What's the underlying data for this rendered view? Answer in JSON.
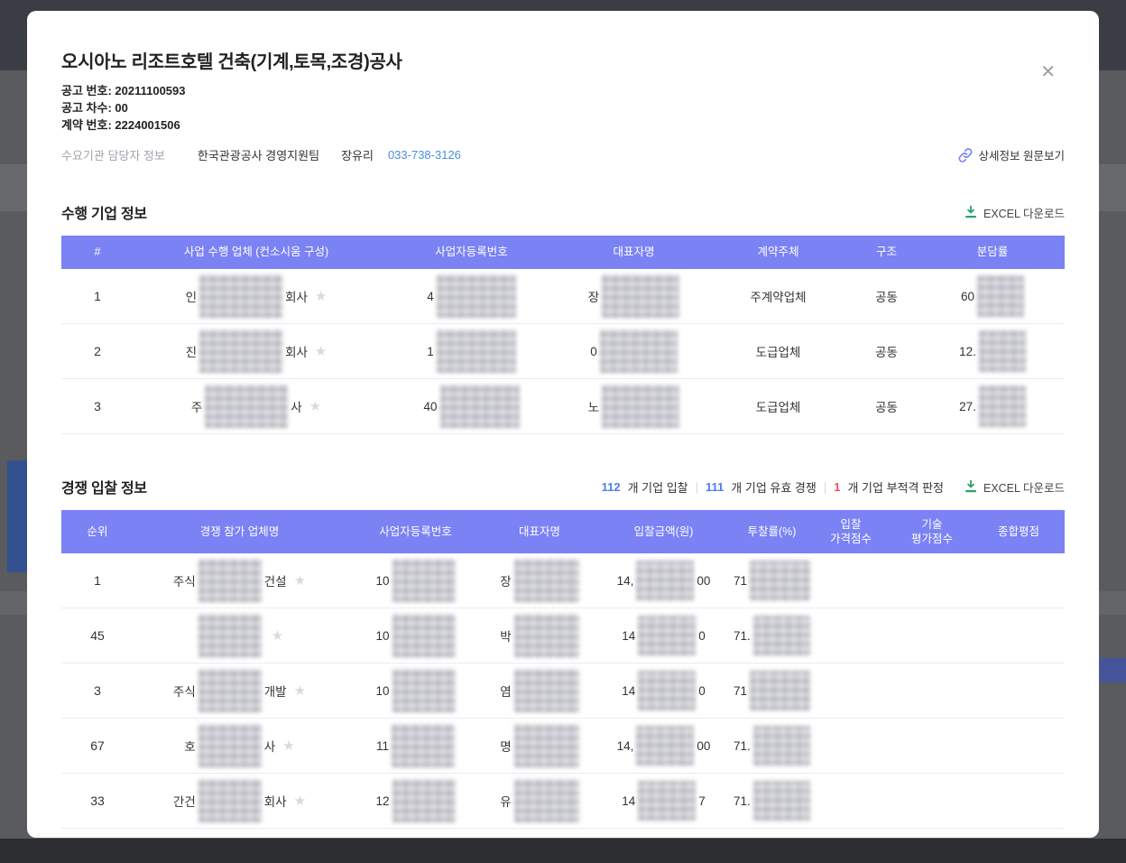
{
  "colors": {
    "table_header": "#7b82f4",
    "phone_link": "#4a8fdb",
    "stat_blue": "#4a7df7",
    "stat_red": "#ef5064",
    "excel_green": "#2ea06b",
    "link_icon_purple": "#7b82f4"
  },
  "icons": {
    "close": "✕",
    "star": "★",
    "separator": "|"
  },
  "modal": {
    "title": "오시아노 리조트호텔 건축(기계,토목,조경)공사",
    "meta": [
      {
        "text": "공고 번호: 20211100593"
      },
      {
        "text": "공고 차수: 00"
      },
      {
        "text": "계약 번호: 2224001506"
      }
    ],
    "contact": {
      "label": "수요기관 담당자 정보",
      "org": "한국관광공사 경영지원팀",
      "person": "장유리",
      "phone": "033-738-3126",
      "detail_link": "상세정보 원문보기"
    }
  },
  "perform_section": {
    "title": "수행 기업 정보",
    "excel_label": "EXCEL 다운로드",
    "table": {
      "headers": [
        "#",
        "사업 수행 업체 (컨소시움 구성)",
        "사업자등록번호",
        "대표자명",
        "계약주체",
        "구조",
        "분담률"
      ],
      "rows": [
        {
          "rank": "1",
          "company_prefix": "인",
          "company_suffix": "회사",
          "biz_prefix": "4",
          "rep_prefix": "장",
          "contract": "주계약업체",
          "structure": "공동",
          "share_prefix": "60"
        },
        {
          "rank": "2",
          "company_prefix": "진",
          "company_suffix": "회사",
          "biz_prefix": "1",
          "rep_prefix": "0",
          "contract": "도급업체",
          "structure": "공동",
          "share_prefix": "12."
        },
        {
          "rank": "3",
          "company_prefix": "주",
          "company_suffix": "사",
          "biz_prefix": "40",
          "rep_prefix": "노",
          "contract": "도급업체",
          "structure": "공동",
          "share_prefix": "27."
        }
      ]
    }
  },
  "bid_section": {
    "title": "경쟁 입찰 정보",
    "stats": [
      {
        "num": "112",
        "text": "개 기업 입찰"
      },
      {
        "num": "111",
        "text": "개 기업 유효 경쟁"
      },
      {
        "num": "1",
        "text": "개 기업 부적격 판정"
      }
    ],
    "excel_label": "EXCEL 다운로드",
    "table": {
      "headers": [
        "순위",
        "경쟁 참가 업체명",
        "사업자등록번호",
        "대표자명",
        "입찰금액(원)",
        "투찰률(%)",
        "입찰\n가격점수",
        "기술\n평가점수",
        "종합평점"
      ],
      "rows": [
        {
          "rank": "1",
          "company_prefix": "주식",
          "company_suffix": "건설",
          "biz_prefix": "10",
          "rep_prefix": "장",
          "amount_prefix": "14,",
          "amount_suffix": "00",
          "rate_prefix": "71"
        },
        {
          "rank": "45",
          "company_prefix": "",
          "company_suffix": "",
          "biz_prefix": "10",
          "rep_prefix": "박",
          "amount_prefix": "14",
          "amount_suffix": "0",
          "rate_prefix": "71."
        },
        {
          "rank": "3",
          "company_prefix": "주식",
          "company_suffix": "개발",
          "biz_prefix": "10",
          "rep_prefix": "염",
          "amount_prefix": "14",
          "amount_suffix": "0",
          "rate_prefix": "71"
        },
        {
          "rank": "67",
          "company_prefix": "호",
          "company_suffix": "사",
          "biz_prefix": "11",
          "rep_prefix": "명",
          "amount_prefix": "14,",
          "amount_suffix": "00",
          "rate_prefix": "71."
        },
        {
          "rank": "33",
          "company_prefix": "간건",
          "company_suffix": "회사",
          "biz_prefix": "12",
          "rep_prefix": "유",
          "amount_prefix": "14",
          "amount_suffix": "7",
          "rate_prefix": "71."
        }
      ]
    }
  }
}
